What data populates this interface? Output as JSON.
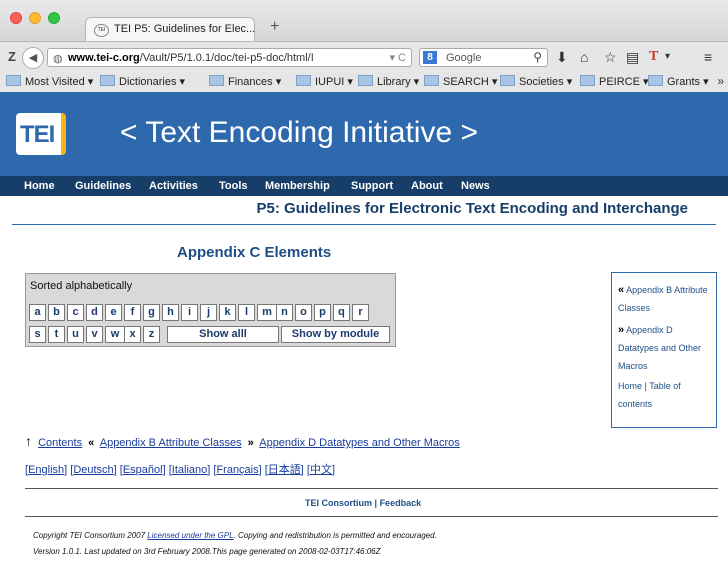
{
  "browser": {
    "tab_title": "TEI P5: Guidelines for Elec...",
    "tab_favicon_text": "TEI",
    "url_domain": "www.tei-c.org",
    "url_path": "/Vault/P5/1.0.1/doc/tei-p5-doc/html/I",
    "search_engine": "Google",
    "search_badge": "8",
    "bookmarks": [
      "Most Visited",
      "Dictionaries",
      "Finances",
      "IUPUI",
      "Library",
      "SEARCH",
      "Societies",
      "PEIRCE",
      "Grants"
    ]
  },
  "banner": {
    "logo": "TEI",
    "title": "< Text Encoding Initiative >",
    "color": "#2d69ac",
    "accent": "#f7b517"
  },
  "nav": [
    "Home",
    "Guidelines",
    "Activities",
    "Tools",
    "Membership",
    "Support",
    "About",
    "News"
  ],
  "page_heading": "P5: Guidelines for Electronic Text Encoding and Interchange",
  "appendix_title": "Appendix C Elements",
  "alpha": {
    "sorted_label": "Sorted alphabetically",
    "row1": [
      "a",
      "b",
      "c",
      "d",
      "e",
      "f",
      "g",
      "h",
      "i",
      "j",
      "k",
      "l",
      "m",
      "n",
      "o",
      "p",
      "q",
      "r"
    ],
    "row2": [
      "s",
      "t",
      "u",
      "v",
      "w",
      "x",
      "z"
    ],
    "show_all": "Show alll",
    "show_module": "Show by module"
  },
  "sidebar": {
    "prev": "Appendix B Attribute Classes",
    "next": "Appendix D Datatypes and Other Macros",
    "home": "Home",
    "separator": "|",
    "toc": "Table of contents"
  },
  "navline": {
    "contents": "Contents",
    "prev": "Appendix B Attribute Classes",
    "next": "Appendix D Datatypes and Other Macros"
  },
  "languages": [
    "English",
    "Deutsch",
    "Español",
    "Italiano",
    "Français",
    "日本語",
    "中文"
  ],
  "footer": {
    "consortium": "TEI Consortium",
    "sep": "|",
    "feedback": "Feedback",
    "copyright_pre": "Copyright TEI Consortium 2007 ",
    "license": "Licensed under the GPL",
    "copyright_post": ". Copying and redistribution is permitted and encouraged.",
    "version": "Version 1.0.1. Last updated on 3rd February 2008.This page generated on 2008-02-03T17:46:06Z"
  }
}
